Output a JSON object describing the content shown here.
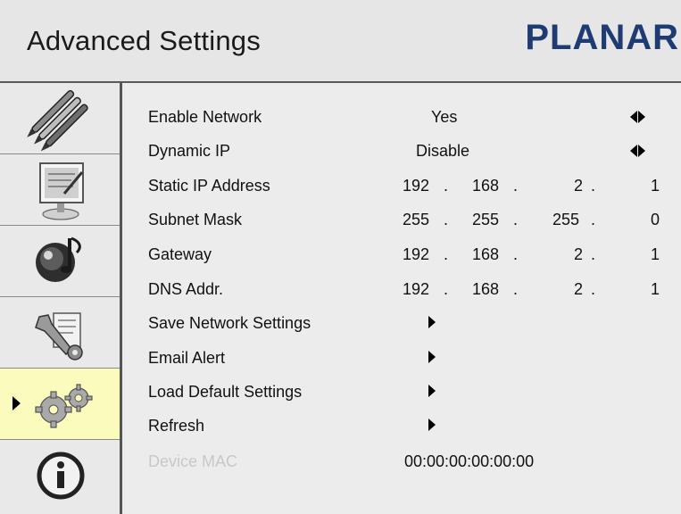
{
  "header": {
    "title": "Advanced Settings",
    "brand": "PLANAR"
  },
  "sidebar": {
    "items": [
      {
        "icon": "pens-icon"
      },
      {
        "icon": "monitor-icon"
      },
      {
        "icon": "audio-icon"
      },
      {
        "icon": "tools-icon"
      },
      {
        "icon": "gears-icon",
        "active": true
      },
      {
        "icon": "info-icon"
      }
    ]
  },
  "settings": {
    "enable_network": {
      "label": "Enable Network",
      "value": "Yes"
    },
    "dynamic_ip": {
      "label": "Dynamic IP",
      "value": "Disable"
    },
    "static_ip": {
      "label": "Static IP Address",
      "o1": "192",
      "o2": "168",
      "o3": "2",
      "o4": "1"
    },
    "subnet_mask": {
      "label": "Subnet Mask",
      "o1": "255",
      "o2": "255",
      "o3": "255",
      "o4": "0"
    },
    "gateway": {
      "label": "Gateway",
      "o1": "192",
      "o2": "168",
      "o3": "2",
      "o4": "1"
    },
    "dns": {
      "label": "DNS Addr.",
      "o1": "192",
      "o2": "168",
      "o3": "2",
      "o4": "1"
    },
    "save_network": {
      "label": "Save Network Settings"
    },
    "email_alert": {
      "label": "Email Alert"
    },
    "load_default": {
      "label": "Load Default Settings"
    },
    "refresh": {
      "label": "Refresh"
    },
    "device_mac": {
      "label": "Device MAC",
      "value": "00:00:00:00:00:00"
    }
  },
  "separator": ".",
  "colors": {
    "brand": "#1e3c73",
    "active_highlight": "#fbfbbe",
    "disabled_text": "#c8c8c8"
  }
}
